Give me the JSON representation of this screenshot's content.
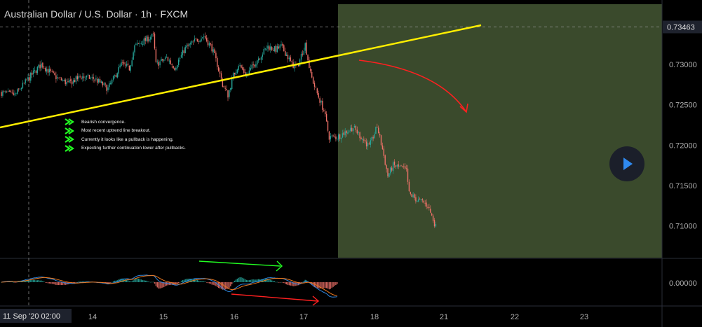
{
  "title": "Australian Dollar / U.S. Dollar · 1h · FXCM",
  "annotations": [
    "Bearish convergence.",
    "Most recent uptrend line breakout.",
    "Currently it looks like a pullback is happening.",
    "Expecting further continuation lower after pullbacks."
  ],
  "chart_data": {
    "type": "candlestick",
    "symbol": "AUDUSD",
    "timeframe": "1h",
    "source": "FXCM",
    "price_axis": {
      "ticks": [
        "0.73000",
        "0.72500",
        "0.72000",
        "0.71500",
        "0.71000"
      ],
      "current_price_label": "0.73463",
      "ylim": [
        0.7085,
        0.7345
      ]
    },
    "macd_axis": {
      "ticks": [
        "0.00000"
      ]
    },
    "time_axis": {
      "ticks": [
        "14",
        "15",
        "16",
        "17",
        "18",
        "21",
        "22",
        "23"
      ],
      "crosshair_label": "11 Sep '20 02:00"
    },
    "price_close_path": [
      [
        0,
        0.7265
      ],
      [
        10,
        0.7262
      ],
      [
        20,
        0.7282
      ],
      [
        30,
        0.73
      ],
      [
        40,
        0.7285
      ],
      [
        50,
        0.7276
      ],
      [
        60,
        0.7285
      ],
      [
        70,
        0.7282
      ],
      [
        80,
        0.727
      ],
      [
        90,
        0.73
      ],
      [
        96,
        0.7295
      ],
      [
        100,
        0.7322
      ],
      [
        108,
        0.733
      ],
      [
        114,
        0.7336
      ],
      [
        116,
        0.73
      ],
      [
        124,
        0.7308
      ],
      [
        130,
        0.7296
      ],
      [
        138,
        0.732
      ],
      [
        146,
        0.733
      ],
      [
        152,
        0.7335
      ],
      [
        158,
        0.732
      ],
      [
        162,
        0.73
      ],
      [
        166,
        0.7275
      ],
      [
        170,
        0.7262
      ],
      [
        174,
        0.7286
      ],
      [
        178,
        0.73
      ],
      [
        184,
        0.7286
      ],
      [
        192,
        0.7306
      ],
      [
        200,
        0.7322
      ],
      [
        206,
        0.7318
      ],
      [
        210,
        0.7322
      ],
      [
        214,
        0.7312
      ],
      [
        218,
        0.73
      ],
      [
        222,
        0.7296
      ],
      [
        226,
        0.7316
      ],
      [
        228,
        0.7325
      ],
      [
        232,
        0.7288
      ],
      [
        236,
        0.7268
      ],
      [
        242,
        0.7243
      ],
      [
        246,
        0.721
      ],
      [
        252,
        0.721
      ],
      [
        258,
        0.7216
      ],
      [
        264,
        0.7222
      ],
      [
        270,
        0.721
      ],
      [
        276,
        0.7198
      ],
      [
        282,
        0.7223
      ],
      [
        286,
        0.7195
      ],
      [
        290,
        0.7162
      ],
      [
        294,
        0.7175
      ],
      [
        300,
        0.7172
      ],
      [
        304,
        0.7168
      ],
      [
        306,
        0.714
      ],
      [
        312,
        0.7132
      ],
      [
        316,
        0.713
      ],
      [
        320,
        0.7125
      ],
      [
        324,
        0.7108
      ],
      [
        326,
        0.7099
      ]
    ],
    "macd": {
      "zero_line": 0.0
    },
    "drawings": {
      "uptrend_line": "yellow",
      "projection_arrow": "red",
      "macd_convergence_arrow": "green",
      "macd_divergence_arrow": "red",
      "highlight_zone": "olive-green"
    }
  },
  "colors": {
    "up": "#26a69a",
    "down": "#ef7168",
    "trendline": "#ffee00",
    "arrow_red": "#ff2020",
    "arrow_green": "#22ff22",
    "zone": "#3a4a2c",
    "macd_line": "#2e86de",
    "signal_line": "#f07a1e"
  }
}
